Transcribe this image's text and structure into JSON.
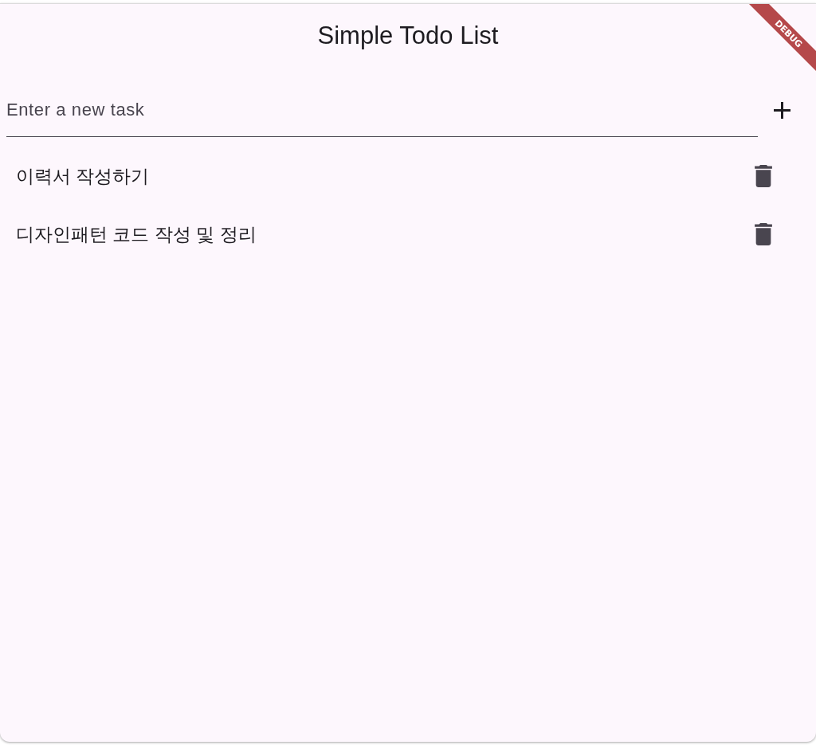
{
  "app_bar": {
    "title": "Simple Todo List"
  },
  "debug_banner": {
    "label": "DEBUG"
  },
  "new_task": {
    "placeholder": "Enter a new task"
  },
  "tasks": [
    {
      "title": "이력서 작성하기"
    },
    {
      "title": "디자인패턴 코드 작성 및 정리"
    }
  ]
}
